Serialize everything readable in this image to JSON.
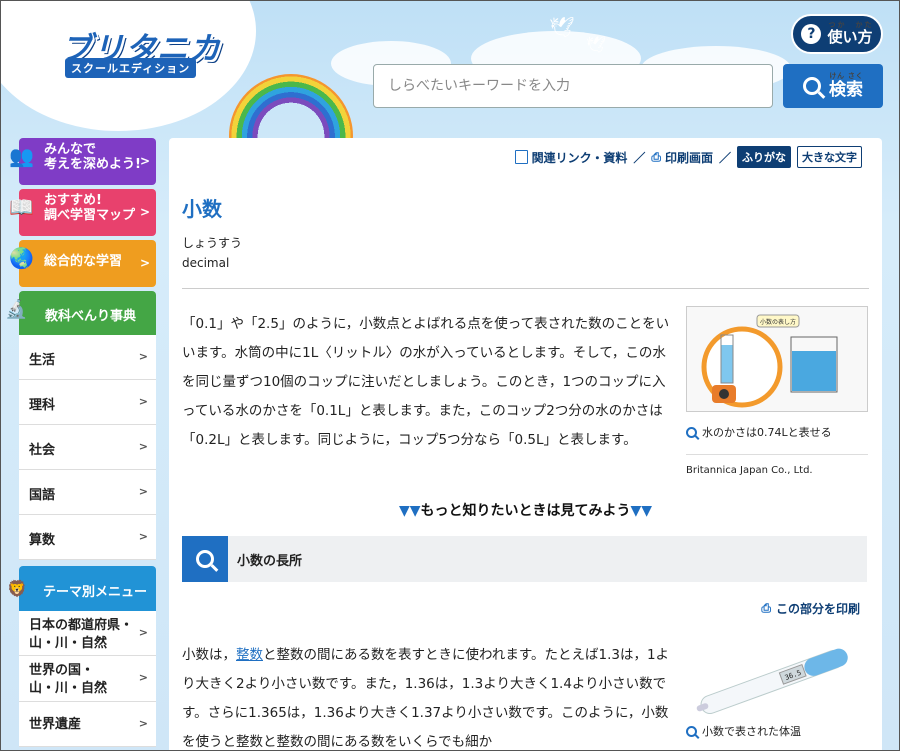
{
  "header": {
    "logo_title": "ブリタニカ",
    "logo_subtitle": "スクールエディション",
    "help_label": "使い方",
    "search_placeholder": "しらべたいキーワードを入力",
    "search_button": "検索"
  },
  "sidebar": {
    "promos": [
      {
        "label1": "みんなで",
        "label2": "考えを深めよう!",
        "color": "#7f3cc6"
      },
      {
        "label1": "おすすめ!",
        "label2": "調べ学習マップ",
        "color": "#e8416d"
      },
      {
        "label1": "",
        "label2": "総合的な学習",
        "color": "#ef9d1f"
      }
    ],
    "subjects_header": "教科べんり事典",
    "subjects": [
      "生活",
      "理科",
      "社会",
      "国語",
      "算数"
    ],
    "theme_header": "テーマ別メニュー",
    "themes": [
      {
        "line1": "日本の都道府県・",
        "line2": "山・川・自然"
      },
      {
        "line1": "世界の国・",
        "line2": "山・川・自然"
      },
      {
        "line1": "世界遺産",
        "line2": ""
      }
    ]
  },
  "toolbar": {
    "related": "関連リンク・資料",
    "print": "印刷画面",
    "furigana": "ふりがな",
    "large_text": "大きな文字",
    "separator": "／"
  },
  "article": {
    "title": "小数",
    "reading": "しょうすう",
    "english": "decimal",
    "paragraph1": "「0.1」や「2.5」のように，小数点とよばれる点を使って表された数のことをいいます。水筒の中に1L〈リットル〉の水が入っているとします。そして，この水を同じ量ずつ10個のコップに注いだとしましょう。このとき，1つのコップに入っている水のかさを「0.1L」と表します。また，このコップ2つ分の水のかさは「0.2L」と表します。同じように，コップ5つ分なら「0.5L」と表します。",
    "figure1_caption": "水のかさは0.74Lと表せる",
    "figure1_label": "小数の表し方",
    "figure1_credit": "Britannica Japan Co., Ltd.",
    "more_label": "もっと知りたいときは見てみよう",
    "section_title": "小数の長所",
    "section_print": "この部分を印刷",
    "p2_before": "小数は，",
    "p2_link": "整数",
    "p2_after": "と整数の間にある数を表すときに使われます。たとえば1.3は，1より大きく2より小さい数です。また，1.36は，1.3より大きく1.4より小さい数です。さらに1.365は，1.36より大きく1.37より小さい数です。このように，小数を使うと整数と整数の間にある数をいくらでも細か",
    "figure2_caption": "小数で表された体温",
    "figure2_reading": "36.5"
  }
}
